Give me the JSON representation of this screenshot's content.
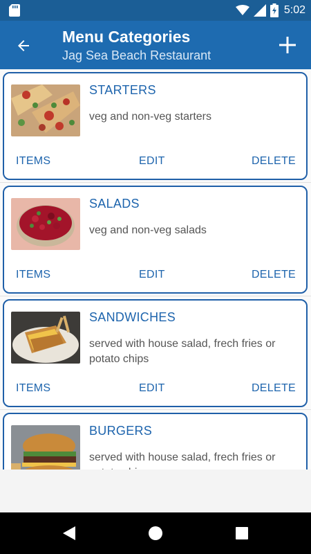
{
  "status_bar": {
    "time": "5:02"
  },
  "app_bar": {
    "title": "Menu Categories",
    "subtitle": "Jag Sea Beach Restaurant"
  },
  "categories": [
    {
      "name": "STARTERS",
      "description": "veg and non-veg starters",
      "items_label": "ITEMS",
      "edit_label": "EDIT",
      "delete_label": "DELETE"
    },
    {
      "name": "SALADS",
      "description": "veg and non-veg salads",
      "items_label": "ITEMS",
      "edit_label": "EDIT",
      "delete_label": "DELETE"
    },
    {
      "name": "SANDWICHES",
      "description": "served with house salad, frech fries or potato chips",
      "items_label": "ITEMS",
      "edit_label": "EDIT",
      "delete_label": "DELETE"
    },
    {
      "name": "BURGERS",
      "description": "served with house salad, frech fries or potato chips"
    }
  ],
  "colors": {
    "status_bar": "#1b5e96",
    "app_bar": "#1e6bb0",
    "accent": "#1d64ad",
    "card_border": "#1f5fa8"
  },
  "icons": {
    "sd_card": "sd-card-icon",
    "wifi": "wifi-icon",
    "signal": "signal-icon",
    "battery": "battery-charging-icon",
    "back": "arrow-back-icon",
    "add": "plus-icon",
    "nav_back": "triangle-back-icon",
    "nav_home": "circle-home-icon",
    "nav_recents": "square-recents-icon"
  }
}
